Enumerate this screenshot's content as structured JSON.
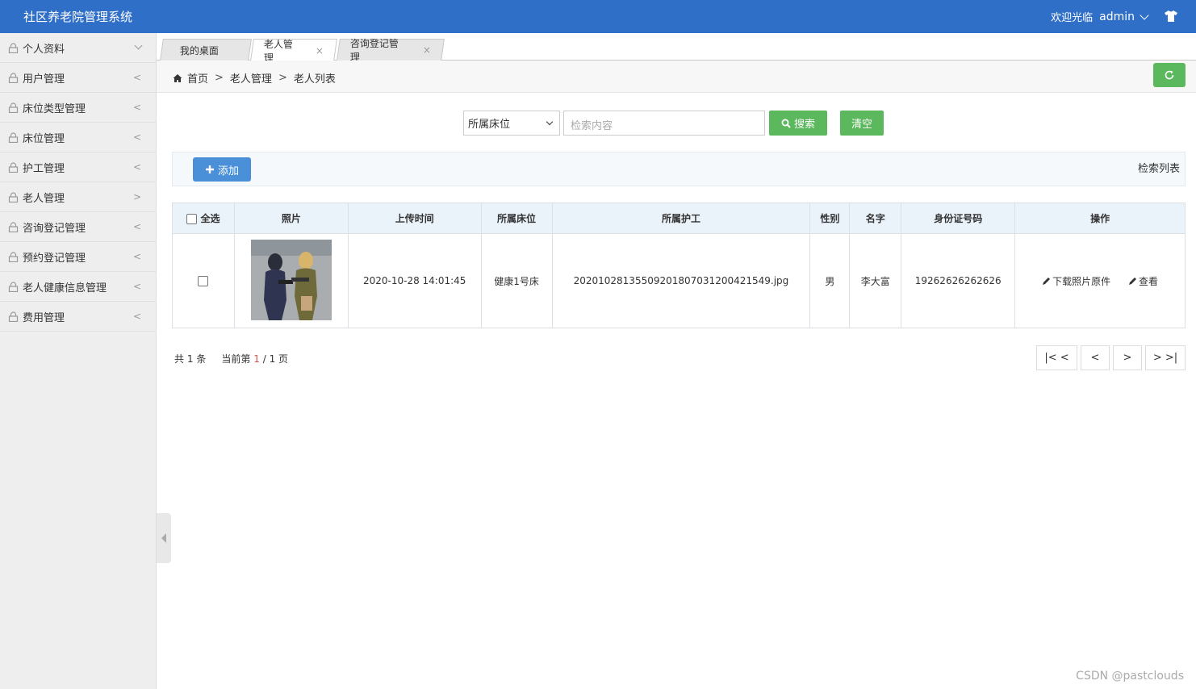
{
  "header": {
    "title": "社区养老院管理系统",
    "welcome": "欢迎光临",
    "username": "admin"
  },
  "sidebar": {
    "items": [
      {
        "label": "个人资料",
        "arrow": "down"
      },
      {
        "label": "用户管理",
        "arrow": "<"
      },
      {
        "label": "床位类型管理",
        "arrow": "<"
      },
      {
        "label": "床位管理",
        "arrow": "<"
      },
      {
        "label": "护工管理",
        "arrow": "<"
      },
      {
        "label": "老人管理",
        "arrow": ">"
      },
      {
        "label": "咨询登记管理",
        "arrow": "<"
      },
      {
        "label": "预约登记管理",
        "arrow": "<"
      },
      {
        "label": "老人健康信息管理",
        "arrow": "<"
      },
      {
        "label": "费用管理",
        "arrow": "<"
      }
    ]
  },
  "tabs": [
    {
      "label": "我的桌面"
    },
    {
      "label": "老人管理",
      "close": "×"
    },
    {
      "label": "咨询登记管理",
      "close": "×"
    }
  ],
  "breadcrumb": {
    "home": "首页",
    "sep": ">",
    "level1": "老人管理",
    "level2": "老人列表"
  },
  "search": {
    "select_value": "所属床位",
    "input_placeholder": "检索内容",
    "search_label": "搜索",
    "clear_label": "清空"
  },
  "toolbar": {
    "add_label": "添加",
    "list_label": "检索列表"
  },
  "table": {
    "headers": [
      "全选",
      "照片",
      "上传时间",
      "所属床位",
      "所属护工",
      "性别",
      "名字",
      "身份证号码",
      "操作"
    ],
    "rows": [
      {
        "upload_time": "2020-10-28 14:01:45",
        "bed": "健康1号床",
        "caregiver": "20201028135509201807031200421549.jpg",
        "gender": "男",
        "name": "李大富",
        "id_number": "19262626262626",
        "op_download": "下载照片原件",
        "op_view": "查看"
      }
    ]
  },
  "pager": {
    "total_prefix": "共",
    "total": "1",
    "total_suffix": "条",
    "page_prefix": "当前第",
    "current": "1",
    "page_mid": "/ 1",
    "page_suffix": "页",
    "first": "|< <",
    "prev": "<",
    "next": ">",
    "last": "> >|"
  },
  "watermark": "CSDN @pastclouds",
  "colors": {
    "topbar": "#2f6fc7",
    "green": "#5cb85c",
    "blue_button": "#4a90d9"
  }
}
